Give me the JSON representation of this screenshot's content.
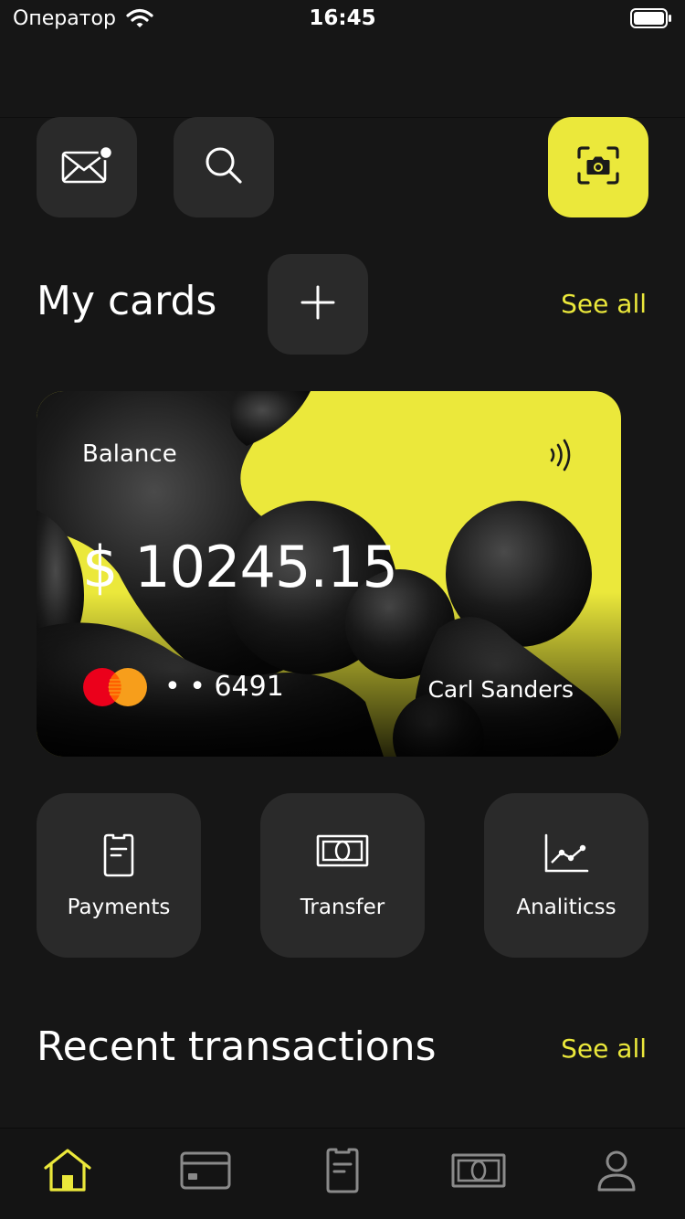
{
  "status_bar": {
    "carrier": "Оператор",
    "time": "16:45"
  },
  "header": {
    "mail_icon": "mail-icon",
    "search_icon": "search-icon",
    "scan_icon": "camera-scan-icon"
  },
  "my_cards": {
    "title": "My cards",
    "see_all": "See all",
    "card": {
      "balance_label": "Balance",
      "balance": "$ 10245.15",
      "number": "• • 6491",
      "holder": "Carl Sanders"
    }
  },
  "actions": [
    {
      "label": "Payments",
      "icon": "receipt-icon"
    },
    {
      "label": "Transfer",
      "icon": "banknote-icon"
    },
    {
      "label": "Analiticss",
      "icon": "chart-icon"
    }
  ],
  "recent": {
    "title": "Recent transactions",
    "see_all": "See all"
  },
  "tabs": [
    {
      "icon": "home-icon",
      "active": true
    },
    {
      "icon": "card-icon",
      "active": false
    },
    {
      "icon": "receipt-icon",
      "active": false
    },
    {
      "icon": "banknote-icon",
      "active": false
    },
    {
      "icon": "profile-icon",
      "active": false
    }
  ],
  "colors": {
    "background": "#161616",
    "surface": "#2a2a2a",
    "accent": "#ebe83b"
  }
}
